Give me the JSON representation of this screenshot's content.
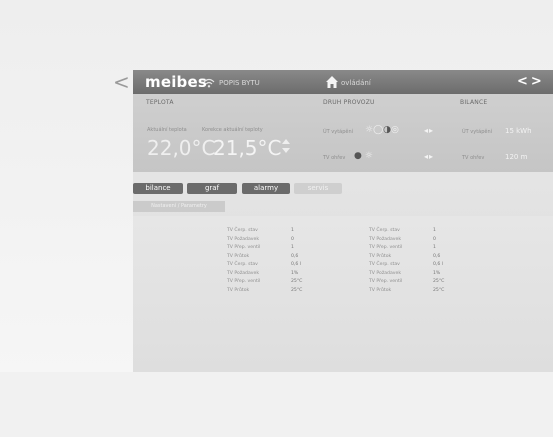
{
  "header": {
    "logo": "meibes",
    "house_label": "POPIS BYTU",
    "home_label": "ovládání",
    "nav_arrows": "<>"
  },
  "back_chevron": "<",
  "teplota": {
    "title": "TEPLOTA",
    "actual_label": "Aktuální teplota",
    "required_label": "Korekce aktuální teploty",
    "actual_value": "22,0°C",
    "required_value": "21,5°C",
    "stepper": "⬆⬇"
  },
  "druh_provozu": {
    "title": "DRUH PROVOZU",
    "row1_label": "ÚT vytápění",
    "row1_icons": "☼◯",
    "row1_icon_dark": "◑",
    "row1_icon_after": "◎",
    "row2_label": "TV ohřev",
    "row2_icons_dark": "●",
    "row2_icons_after": "☼",
    "arrows": "◂▸"
  },
  "bilance": {
    "title": "BILANCE",
    "row1_label": "ÚT vytápění",
    "row1_value": "15 kWh",
    "row2_label": "TV ohřev",
    "row2_value": "120 m"
  },
  "tabs": [
    {
      "label": "bilance"
    },
    {
      "label": "graf"
    },
    {
      "label": "alarmy"
    },
    {
      "label": "servis"
    }
  ],
  "subtab_label": "Nastavení / Parametry",
  "stats_left": [
    {
      "label": "TV Čerp. stav",
      "value": "1"
    },
    {
      "label": "TV Požadavek",
      "value": "0"
    },
    {
      "label": "TV Přep. ventil",
      "value": "1"
    },
    {
      "label": "TV Průtok",
      "value": "0,6"
    },
    {
      "label": "TV Čerp. stav",
      "value": "0,6 l"
    },
    {
      "label": "TV Požadavek",
      "value": "1%"
    },
    {
      "label": "TV Přep. ventil",
      "value": "25°C"
    },
    {
      "label": "TV Průtok",
      "value": "25°C"
    }
  ],
  "stats_right": [
    {
      "label": "TV Čerp. stav",
      "value": "1"
    },
    {
      "label": "TV Požadavek",
      "value": "0"
    },
    {
      "label": "TV Přep. ventil",
      "value": "1"
    },
    {
      "label": "TV Průtok",
      "value": "0,6"
    },
    {
      "label": "TV Čerp. stav",
      "value": "0,6 l"
    },
    {
      "label": "TV Požadavek",
      "value": "1%"
    },
    {
      "label": "TV Přep. ventil",
      "value": "25°C"
    },
    {
      "label": "TV Průtok",
      "value": "25°C"
    }
  ],
  "colors": {
    "topbar": "#7a7a7a",
    "tab": "#6b6b6b",
    "panel": "#e2e2e2"
  }
}
